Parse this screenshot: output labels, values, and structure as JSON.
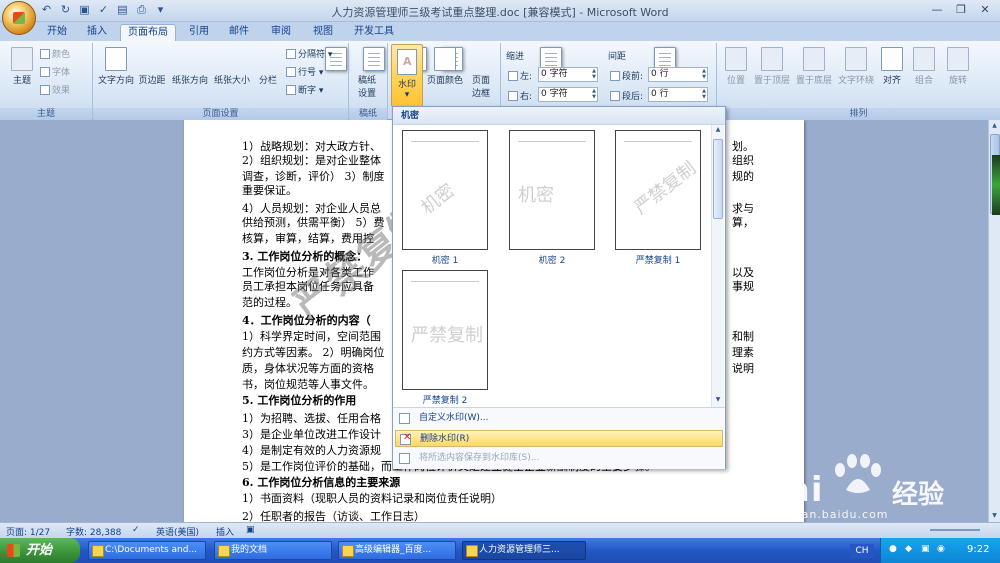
{
  "window": {
    "title": "人力资源管理师三级考试重点整理.doc [兼容模式] - Microsoft Word",
    "controls": [
      "—",
      "❐",
      "✕"
    ]
  },
  "tabs": [
    "开始",
    "插入",
    "页面布局",
    "引用",
    "邮件",
    "审阅",
    "视图",
    "开发工具"
  ],
  "active_tab": "页面布局",
  "ribbon": {
    "theme_group": {
      "label": "主题",
      "theme_btn": "主题",
      "colors": "颜色",
      "fonts": "字体",
      "effects": "效果"
    },
    "page_setup_group": {
      "label": "页面设置",
      "text_direction": "文字方向",
      "margins": "页边距",
      "orientation": "纸张方向",
      "size": "纸张大小",
      "columns": "分栏",
      "breaks": "分隔符",
      "line_numbers": "行号",
      "hyphenation": "断字"
    },
    "draft_group": {
      "label": "稿纸",
      "draft_settings_1": "稿纸",
      "draft_settings_2": "设置"
    },
    "page_bg_group": {
      "watermark": "水印",
      "page_color": "页面颜色",
      "page_borders_1": "页面",
      "page_borders_2": "边框"
    },
    "paragraph_group": {
      "indent_title": "缩进",
      "spacing_title": "间距",
      "left_label": "左:",
      "right_label": "右:",
      "before_label": "段前:",
      "after_label": "段后:",
      "left_value": "0 字符",
      "right_value": "0 字符",
      "before_value": "0 行",
      "after_value": "0 行"
    },
    "arrange_group": {
      "label": "排列",
      "position": "位置",
      "bring_front": "置于顶层",
      "send_back": "置于底层",
      "text_wrap": "文字环绕",
      "align": "对齐",
      "group": "组合",
      "rotate": "旋转"
    }
  },
  "document": {
    "lines": [
      "1）战略规划：对大政方针、",
      "2）组织规划：是对企业整体",
      "调查，诊断，评价） 3）制度",
      "重要保证。",
      "4）人员规划：对企业人员总",
      "供给预测，供需平衡） 5）费",
      "核算，审算，结算，费用控",
      "3. 工作岗位分析的概念：",
      " 工作岗位分析是对各类工作",
      "员工承担本岗位任务应具备",
      "范的过程。",
      "4．工作岗位分析的内容（",
      "1）科学界定时间，空间范围",
      "约方式等因素。 2）明确岗位",
      "质，身体状况等方面的资格",
      "书，岗位规范等人事文件。",
      "5. 工作岗位分析的作用",
      "1）为招聘、选拔、任用合格",
      "3）是企业单位改进工作设计",
      "4）是制定有效的人力资源规",
      "5）是工作岗位评价的基础，而工作岗位评价又是建立健全企业薪酬制度的重要步骤。",
      "6. 工作岗位分析信息的主要来源",
      "1）书面资料（现职人员的资料记录和岗位责任说明）",
      "2）任职者的报告（访谈、工作日志）"
    ],
    "right_fragments": [
      {
        "line": 1,
        "text": "划。"
      },
      {
        "line": 2,
        "text": "组织"
      },
      {
        "line": 3,
        "text": "规的"
      },
      {
        "line": 5,
        "text": "求与"
      },
      {
        "line": 6,
        "text": "算，"
      },
      {
        "line": 9,
        "text": "以及"
      },
      {
        "line": 10,
        "text": "事规"
      },
      {
        "line": 13,
        "text": "和制"
      },
      {
        "line": 14,
        "text": "理素"
      },
      {
        "line": 15,
        "text": "说明"
      }
    ],
    "watermark_text": "严禁复制"
  },
  "watermark_gallery": {
    "header": "机密",
    "items": [
      {
        "caption": "机密 1",
        "text": "机密",
        "style": "diag"
      },
      {
        "caption": "机密 2",
        "text": "机密",
        "style": "horiz"
      },
      {
        "caption": "严禁复制 1",
        "text": "严禁复制",
        "style": "diag"
      },
      {
        "caption": "严禁复制 2",
        "text": "严禁复制",
        "style": "horiz"
      }
    ],
    "menu": {
      "custom": "自定义水印(W)...",
      "remove": "删除水印(R)",
      "save": "将所选内容保存到水印库(S)..."
    }
  },
  "statusbar": {
    "page": "页面: 1/27",
    "words": "字数: 28,388",
    "language": "英语(美国)",
    "mode": "插入"
  },
  "taskbar": {
    "start": "开始",
    "tasks": [
      "C:\\Documents and...",
      "我的文档",
      "高级编辑器_百度...",
      "人力资源管理师三..."
    ],
    "ime": "CH",
    "time": "9:22"
  },
  "baidu": {
    "brand": "Bai",
    "brand2": "经验",
    "url": "jingyan.baidu.com"
  },
  "colors": {
    "ribbon": "#dce8f6",
    "highlight": "#ffd863",
    "taskbar": "#2457c5"
  }
}
